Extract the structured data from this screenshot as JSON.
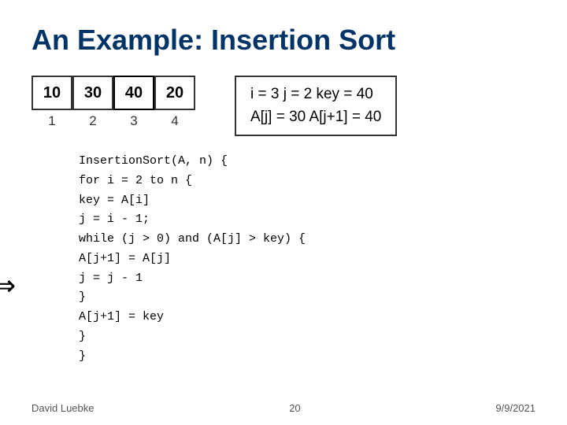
{
  "title": "An Example: Insertion Sort",
  "array": {
    "cells": [
      "10",
      "30",
      "40",
      "20"
    ],
    "indices": [
      "1",
      "2",
      "3",
      "4"
    ]
  },
  "info": {
    "line1": "i = 3    j = 2    key = 40",
    "line2": "A[j] = 30         A[j+1] = 40"
  },
  "code": {
    "lines": [
      "InsertionSort(A, n) {",
      "  for i = 2 to n {",
      "      key = A[i]",
      "      j = i - 1;",
      "      while (j > 0) and (A[j] > key) {",
      "              A[j+1] = A[j]",
      "              j = j - 1",
      "      }",
      "      A[j+1] = key",
      "  }",
      "}"
    ]
  },
  "footer": {
    "left": "David Luebke",
    "center": "20",
    "right": "9/9/2021"
  }
}
